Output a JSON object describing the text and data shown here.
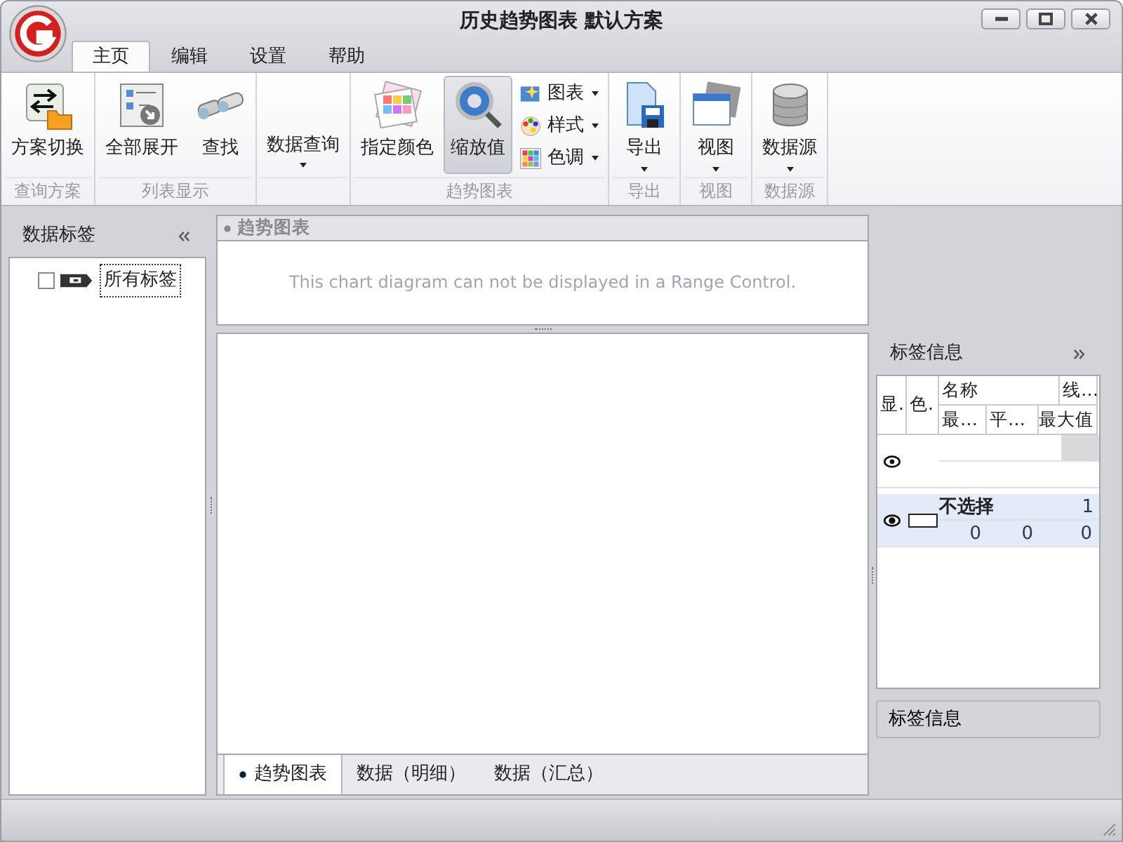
{
  "window": {
    "title": "历史趋势图表 默认方案"
  },
  "tabs": [
    {
      "label": "主页",
      "selected": true
    },
    {
      "label": "编辑",
      "selected": false
    },
    {
      "label": "设置",
      "selected": false
    },
    {
      "label": "帮助",
      "selected": false
    }
  ],
  "ribbon_groups": [
    {
      "label": "查询方案",
      "buttons": [
        {
          "kind": "large",
          "label": "方案切换",
          "dropdown": false,
          "pressed": false
        }
      ]
    },
    {
      "label": "列表显示",
      "buttons": [
        {
          "kind": "large",
          "label": "全部展开",
          "dropdown": false,
          "pressed": false
        },
        {
          "kind": "large",
          "label": "查找",
          "dropdown": false,
          "pressed": false
        }
      ]
    },
    {
      "buttons": [
        {
          "kind": "large",
          "label": "数据查询",
          "dropdown": true,
          "pressed": false
        }
      ]
    },
    {
      "label": "趋势图表",
      "buttons": [
        {
          "kind": "large",
          "label": "指定颜色",
          "dropdown": false,
          "pressed": false
        },
        {
          "kind": "large",
          "label": "缩放值",
          "dropdown": false,
          "pressed": true
        },
        {
          "kind": "small",
          "label": "图表",
          "dropdown": true,
          "pressed": false
        },
        {
          "kind": "small",
          "label": "样式",
          "dropdown": true,
          "pressed": false
        },
        {
          "kind": "small",
          "label": "色调",
          "dropdown": true,
          "pressed": false
        }
      ]
    },
    {
      "label": "导出",
      "buttons": [
        {
          "kind": "large",
          "label": "导出",
          "dropdown": true,
          "pressed": false
        }
      ]
    },
    {
      "label": "视图",
      "buttons": [
        {
          "kind": "large",
          "label": "视图",
          "dropdown": true,
          "pressed": false
        }
      ]
    },
    {
      "label": "数据源",
      "buttons": [
        {
          "kind": "large",
          "label": "数据源",
          "dropdown": true,
          "pressed": false
        }
      ]
    }
  ],
  "left_panel": {
    "title": "数据标签",
    "tree": [
      {
        "label": "所有标签",
        "checked": false,
        "selected": true
      }
    ]
  },
  "range_panel": {
    "title": "趋势图表",
    "message": "This chart diagram can not be displayed in a Range Control."
  },
  "bottom_tabs": [
    {
      "label": "趋势图表",
      "selected": true
    },
    {
      "label": "数据（明细）",
      "selected": false
    },
    {
      "label": "数据（汇总）",
      "selected": false
    }
  ],
  "right_panel": {
    "title": "标签信息",
    "columns": {
      "visible": "显.",
      "swatch": "色.",
      "name": "名称",
      "line": "线…",
      "min": "最…",
      "avg": "平…",
      "max": "最大值"
    },
    "rows": [
      {
        "visible": true,
        "selected": false
      },
      {
        "visible": true,
        "selected": true,
        "color": "#ffffff",
        "name": "不选择",
        "line": "1",
        "min": "0",
        "avg": "0",
        "max": "0"
      }
    ],
    "footer_tab": "标签信息"
  }
}
